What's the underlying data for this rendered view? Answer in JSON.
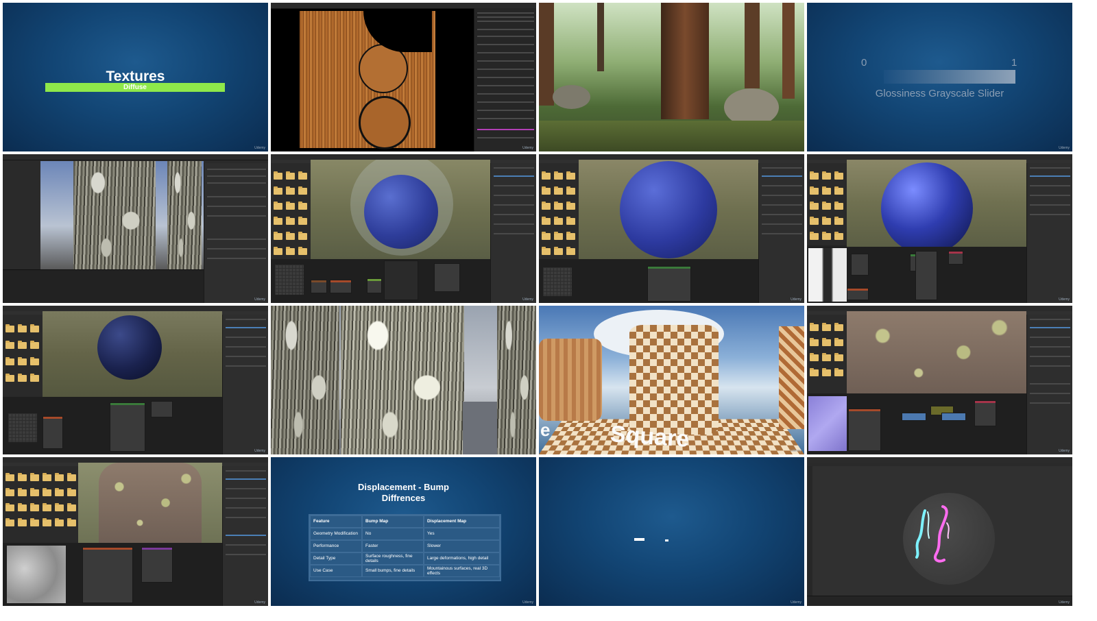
{
  "tiles": {
    "textures": {
      "title": "Textures",
      "subtitle": "Diffuse",
      "watermark": "Udemy"
    },
    "wood_uv": {
      "watermark": "Udemy"
    },
    "forest": {
      "watermark": ""
    },
    "glossiness": {
      "min": "0",
      "max": "1",
      "caption": "Glossiness Grayscale Slider",
      "watermark": "Udemy"
    },
    "bark_unity": {
      "watermark": "Udemy"
    },
    "sphere_1": {
      "watermark": "Udemy"
    },
    "sphere_2": {
      "watermark": "Udemy"
    },
    "sphere_3": {
      "watermark": "Udemy"
    },
    "sphere_dark": {
      "watermark": "Udemy"
    },
    "bark_closeup": {
      "watermark": ""
    },
    "square": {
      "label": "Square",
      "watermark": "Udemy"
    },
    "ground_nodes": {
      "watermark": "Udemy"
    },
    "ground_displace": {
      "watermark": "Udemy"
    },
    "displacement": {
      "title_line1": "Displacement - Bump",
      "title_line2": "Diffrences",
      "watermark": "Udemy",
      "table": {
        "headers": [
          "Feature",
          "Bump Map",
          "Displacement Map"
        ],
        "rows": [
          [
            "Geometry Modification",
            "No",
            "Yes"
          ],
          [
            "Performance",
            "Faster",
            "Slower"
          ],
          [
            "Detail Type",
            "Surface roughness, fine details",
            "Large deformations, high detail"
          ],
          [
            "Use Case",
            "Small bumps, fine details",
            "Mountainous surfaces, real 3D effects"
          ]
        ]
      }
    },
    "blank_blue": {
      "watermark": "Udemy"
    },
    "neon": {
      "watermark": "Udemy"
    }
  },
  "colors": {
    "accent_green": "#8ee84a",
    "blender_blue_row": "#4b7fb6",
    "neon_cyan": "#7df2ff",
    "neon_pink": "#ff6cf0"
  },
  "icons": [
    "folder-icon",
    "node-icon"
  ]
}
